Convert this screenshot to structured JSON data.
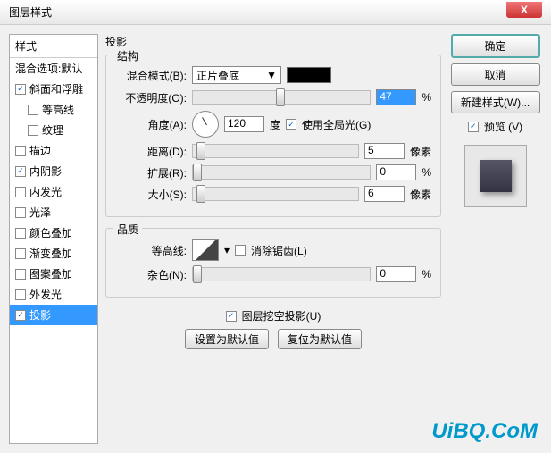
{
  "title": "图层样式",
  "sidebar": {
    "header": "样式",
    "items": [
      {
        "label": "混合选项:默认",
        "checked": null
      },
      {
        "label": "斜面和浮雕",
        "checked": true
      },
      {
        "label": "等高线",
        "checked": false,
        "indent": true
      },
      {
        "label": "纹理",
        "checked": false,
        "indent": true
      },
      {
        "label": "描边",
        "checked": false
      },
      {
        "label": "内阴影",
        "checked": true
      },
      {
        "label": "内发光",
        "checked": false
      },
      {
        "label": "光泽",
        "checked": false
      },
      {
        "label": "颜色叠加",
        "checked": false
      },
      {
        "label": "渐变叠加",
        "checked": false
      },
      {
        "label": "图案叠加",
        "checked": false
      },
      {
        "label": "外发光",
        "checked": false
      },
      {
        "label": "投影",
        "checked": true,
        "selected": true
      }
    ]
  },
  "panel": {
    "title": "投影",
    "structure": {
      "title": "结构",
      "blend_label": "混合模式(B):",
      "blend_value": "正片叠底",
      "opacity_label": "不透明度(O):",
      "opacity_value": "47",
      "opacity_unit": "%",
      "angle_label": "角度(A):",
      "angle_value": "120",
      "angle_unit": "度",
      "global_light": "使用全局光(G)",
      "distance_label": "距离(D):",
      "distance_value": "5",
      "distance_unit": "像素",
      "spread_label": "扩展(R):",
      "spread_value": "0",
      "spread_unit": "%",
      "size_label": "大小(S):",
      "size_value": "6",
      "size_unit": "像素"
    },
    "quality": {
      "title": "品质",
      "contour_label": "等高线:",
      "antialias": "消除锯齿(L)",
      "noise_label": "杂色(N):",
      "noise_value": "0",
      "noise_unit": "%"
    },
    "knockout": "图层挖空投影(U)",
    "set_default": "设置为默认值",
    "reset_default": "复位为默认值"
  },
  "buttons": {
    "ok": "确定",
    "cancel": "取消",
    "new_style": "新建样式(W)...",
    "preview": "预览 (V)"
  },
  "watermark": "UiBQ.CoM"
}
